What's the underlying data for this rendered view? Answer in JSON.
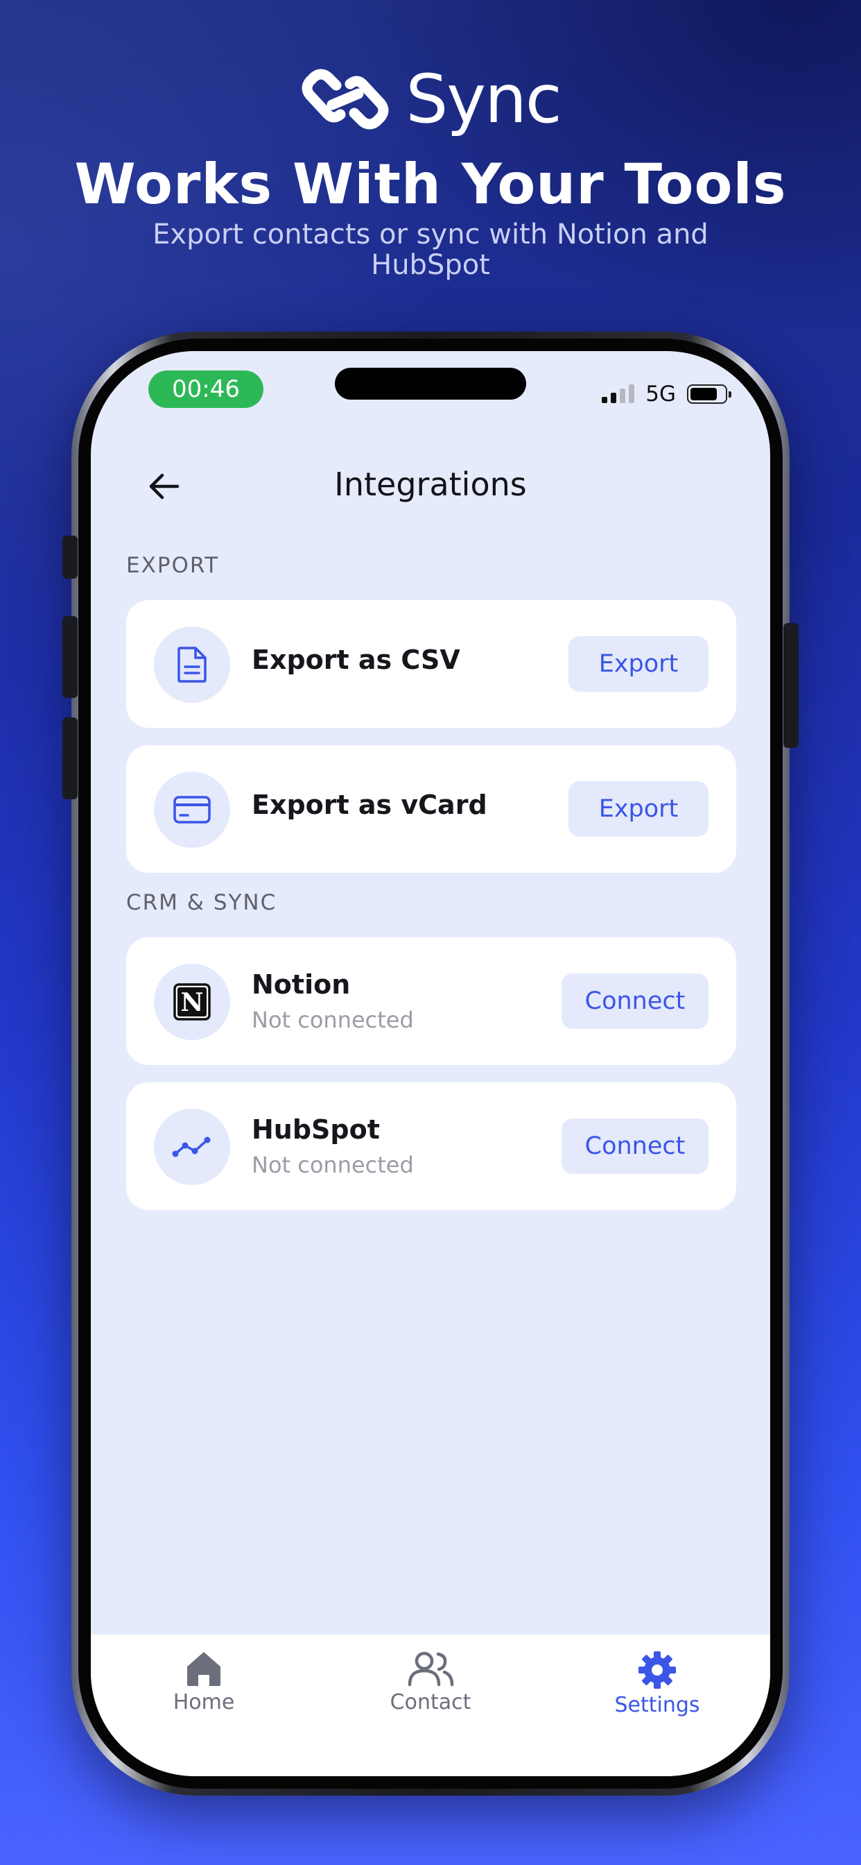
{
  "brand": {
    "name": "Sync",
    "logo_icon": "link-chain-icon"
  },
  "hero": {
    "headline": "Works With Your Tools",
    "subhead": "Export contacts or sync with Notion and HubSpot"
  },
  "status_bar": {
    "time": "00:46",
    "network": "5G",
    "battery_level": 0.8
  },
  "header": {
    "title": "Integrations",
    "back_icon": "arrow-left-icon"
  },
  "sections": {
    "export": {
      "label": "EXPORT",
      "items": [
        {
          "title": "Export as CSV",
          "icon": "document-icon",
          "button": "Export"
        },
        {
          "title": "Export as vCard",
          "icon": "credit-card-icon",
          "button": "Export"
        }
      ]
    },
    "crm": {
      "label": "CRM & SYNC",
      "items": [
        {
          "title": "Notion",
          "subtitle": "Not connected",
          "icon": "notion-logo-icon",
          "notion_letter": "N",
          "button": "Connect"
        },
        {
          "title": "HubSpot",
          "subtitle": "Not connected",
          "icon": "trend-line-icon",
          "button": "Connect"
        }
      ]
    }
  },
  "tab_bar": {
    "tabs": [
      {
        "label": "Home",
        "icon": "home-icon",
        "active": false
      },
      {
        "label": "Contact",
        "icon": "people-icon",
        "active": false
      },
      {
        "label": "Settings",
        "icon": "gear-icon",
        "active": true
      }
    ]
  },
  "colors": {
    "accent": "#3b55e6",
    "inactive_tab": "#6b6f7c",
    "status_pill": "#2db857",
    "screen_bg": "#e6ebfc"
  }
}
